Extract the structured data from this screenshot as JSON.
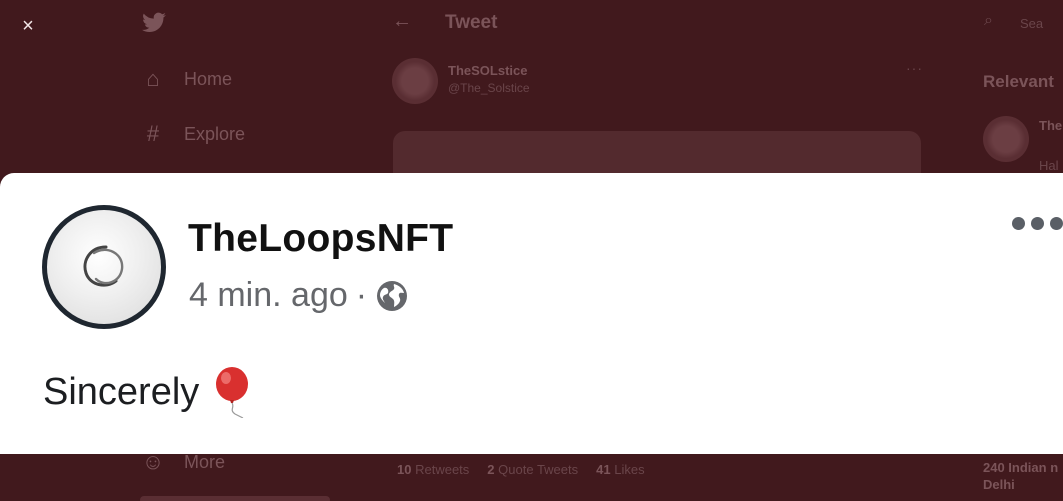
{
  "background": {
    "close_glyph": "×",
    "nav": [
      {
        "label": "Home",
        "icon": "home-icon",
        "glyph": "⌂"
      },
      {
        "label": "Explore",
        "icon": "hashtag-icon",
        "glyph": "#"
      }
    ],
    "more_label": "More",
    "more_icon_glyph": "☺",
    "header": {
      "back_glyph": "←",
      "title": "Tweet"
    },
    "tweet": {
      "author_name": "TheSOLstice",
      "author_handle": "@The_Solstice",
      "more_glyph": "···",
      "stats": [
        {
          "count": "10",
          "label": "Retweets"
        },
        {
          "count": "2",
          "label": "Quote Tweets"
        },
        {
          "count": "41",
          "label": "Likes"
        }
      ]
    },
    "sidebar": {
      "search_glyph": "⌕",
      "search_placeholder": "Sea",
      "relevant_title": "Relevant",
      "relevant_name": "The",
      "relevant_sub": "Hal",
      "trend_line1": "240 Indian n",
      "trend_line2": "Delhi"
    }
  },
  "card": {
    "author": "TheLoopsNFT",
    "time": "4 min. ago",
    "separator": "·",
    "privacy_icon": "globe-icon",
    "post_text": "Sincerely",
    "post_emoji": "balloon-emoji",
    "more_icon": "more-horizontal-icon"
  },
  "colors": {
    "overlay": "#41191d",
    "card_background": "#ffffff",
    "text_primary": "#1c1e21",
    "text_secondary": "#65676b",
    "balloon": "#d9302f"
  }
}
